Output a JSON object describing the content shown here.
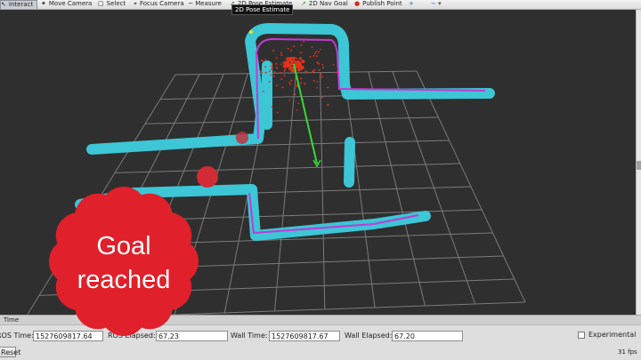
{
  "toolbar": {
    "interact": "Interact",
    "move_camera": "Move Camera",
    "select": "Select",
    "focus_camera": "Focus Camera",
    "measure": "Measure",
    "pose_estimate_partial": "2D Pose Estimate",
    "nav_goal": "2D Nav Goal",
    "publish_point": "Publish Point",
    "plus_icon": "+",
    "minus_icon": "−",
    "dropdown_icon": "▾"
  },
  "tooltip": "2D Pose Estimate",
  "time_panel": {
    "title": "Time",
    "ros_time_label": "ROS Time:",
    "ros_time_value": "1527609817.64",
    "ros_elapsed_label": "ROS Elapsed:",
    "ros_elapsed_value": "67.23",
    "wall_time_label": "Wall Time:",
    "wall_time_value": "1527609817.67",
    "wall_elapsed_label": "Wall Elapsed:",
    "wall_elapsed_value": "67.20",
    "experimental_label": "Experimental",
    "experimental_checked": false,
    "reset_label": "Reset",
    "fps": "31 fps"
  },
  "overlay": {
    "line1": "Goal",
    "line2": "reached",
    "color": "#e0202a"
  },
  "colors": {
    "map_cyan": "#3cc6d6",
    "path_magenta": "#c23ad6",
    "particles": "#e4321a",
    "heading": "#38d838",
    "grid": "#7b7b7b",
    "background": "#2f2f2f"
  }
}
